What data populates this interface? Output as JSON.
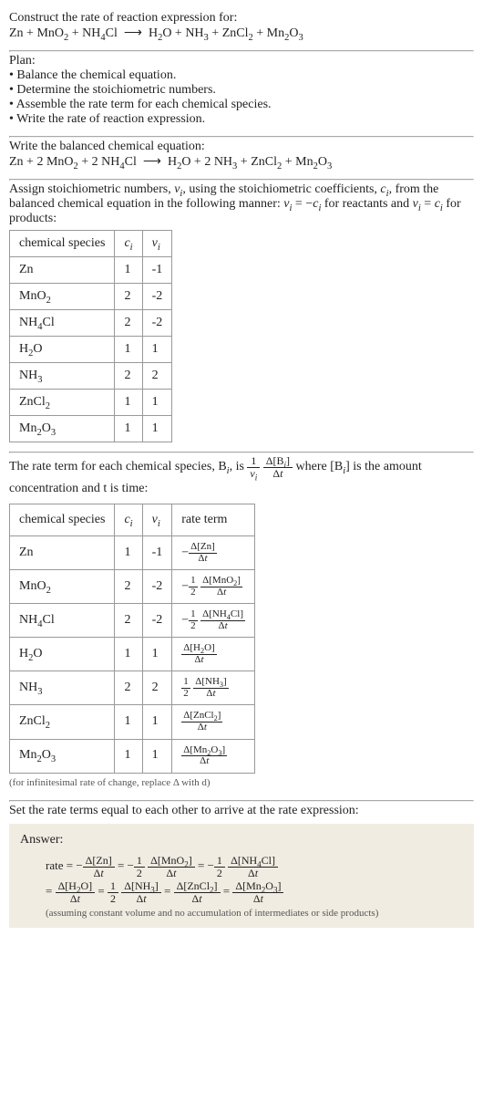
{
  "header": {
    "title": "Construct the rate of reaction expression for:",
    "equation_html": "Zn + MnO<sub>2</sub> + NH<sub>4</sub>Cl &nbsp;⟶&nbsp; H<sub>2</sub>O + NH<sub>3</sub> + ZnCl<sub>2</sub> + Mn<sub>2</sub>O<sub>3</sub>"
  },
  "plan": {
    "label": "Plan:",
    "items": [
      "Balance the chemical equation.",
      "Determine the stoichiometric numbers.",
      "Assemble the rate term for each chemical species.",
      "Write the rate of reaction expression."
    ]
  },
  "balanced": {
    "label": "Write the balanced chemical equation:",
    "equation_html": "Zn + 2 MnO<sub>2</sub> + 2 NH<sub>4</sub>Cl &nbsp;⟶&nbsp; H<sub>2</sub>O + 2 NH<sub>3</sub> + ZnCl<sub>2</sub> + Mn<sub>2</sub>O<sub>3</sub>"
  },
  "stoich_intro_html": "Assign stoichiometric numbers, <i>ν<sub>i</sub></i>, using the stoichiometric coefficients, <i>c<sub>i</sub></i>, from the balanced chemical equation in the following manner: <i>ν<sub>i</sub></i> = −<i>c<sub>i</sub></i> for reactants and <i>ν<sub>i</sub></i> = <i>c<sub>i</sub></i> for products:",
  "stoich_table": {
    "headers": [
      "chemical species",
      "c_i",
      "ν_i"
    ],
    "rows": [
      {
        "species_html": "Zn",
        "c": "1",
        "nu": "-1"
      },
      {
        "species_html": "MnO<sub>2</sub>",
        "c": "2",
        "nu": "-2"
      },
      {
        "species_html": "NH<sub>4</sub>Cl",
        "c": "2",
        "nu": "-2"
      },
      {
        "species_html": "H<sub>2</sub>O",
        "c": "1",
        "nu": "1"
      },
      {
        "species_html": "NH<sub>3</sub>",
        "c": "2",
        "nu": "2"
      },
      {
        "species_html": "ZnCl<sub>2</sub>",
        "c": "1",
        "nu": "1"
      },
      {
        "species_html": "Mn<sub>2</sub>O<sub>3</sub>",
        "c": "1",
        "nu": "1"
      }
    ]
  },
  "rate_term_intro": {
    "pre": "The rate term for each chemical species, B",
    "mid1": ", is ",
    "frac1_num": "1",
    "frac1_den_html": "<i>ν<sub>i</sub></i>",
    "frac2_num_html": "Δ[B<sub><i>i</i></sub>]",
    "frac2_den_html": "Δ<i>t</i>",
    "mid2": " where [B",
    "post": "] is the amount concentration and t is time:"
  },
  "rate_table": {
    "headers": [
      "chemical species",
      "c_i",
      "ν_i",
      "rate term"
    ],
    "rows": [
      {
        "species_html": "Zn",
        "c": "1",
        "nu": "-1",
        "rate_html": "−<span class=\"frac\"><span class=\"num\">Δ[Zn]</span><span class=\"den\">Δ<i>t</i></span></span>"
      },
      {
        "species_html": "MnO<sub>2</sub>",
        "c": "2",
        "nu": "-2",
        "rate_html": "−<span class=\"frac\"><span class=\"num\">1</span><span class=\"den\">2</span></span> <span class=\"frac\"><span class=\"num\">Δ[MnO<sub>2</sub>]</span><span class=\"den\">Δ<i>t</i></span></span>"
      },
      {
        "species_html": "NH<sub>4</sub>Cl",
        "c": "2",
        "nu": "-2",
        "rate_html": "−<span class=\"frac\"><span class=\"num\">1</span><span class=\"den\">2</span></span> <span class=\"frac\"><span class=\"num\">Δ[NH<sub>4</sub>Cl]</span><span class=\"den\">Δ<i>t</i></span></span>"
      },
      {
        "species_html": "H<sub>2</sub>O",
        "c": "1",
        "nu": "1",
        "rate_html": "<span class=\"frac\"><span class=\"num\">Δ[H<sub>2</sub>O]</span><span class=\"den\">Δ<i>t</i></span></span>"
      },
      {
        "species_html": "NH<sub>3</sub>",
        "c": "2",
        "nu": "2",
        "rate_html": "<span class=\"frac\"><span class=\"num\">1</span><span class=\"den\">2</span></span> <span class=\"frac\"><span class=\"num\">Δ[NH<sub>3</sub>]</span><span class=\"den\">Δ<i>t</i></span></span>"
      },
      {
        "species_html": "ZnCl<sub>2</sub>",
        "c": "1",
        "nu": "1",
        "rate_html": "<span class=\"frac\"><span class=\"num\">Δ[ZnCl<sub>2</sub>]</span><span class=\"den\">Δ<i>t</i></span></span>"
      },
      {
        "species_html": "Mn<sub>2</sub>O<sub>3</sub>",
        "c": "1",
        "nu": "1",
        "rate_html": "<span class=\"frac\"><span class=\"num\">Δ[Mn<sub>2</sub>O<sub>3</sub>]</span><span class=\"den\">Δ<i>t</i></span></span>"
      }
    ],
    "note": "(for infinitesimal rate of change, replace Δ with d)"
  },
  "set_equal": "Set the rate terms equal to each other to arrive at the rate expression:",
  "answer": {
    "label": "Answer:",
    "line1_html": "rate = −<span class=\"inline-frac\"><span class=\"num\">Δ[Zn]</span><span class=\"den\">Δ<i>t</i></span></span> = −<span class=\"inline-frac\"><span class=\"num\">1</span><span class=\"den\">2</span></span> <span class=\"inline-frac\"><span class=\"num\">Δ[MnO<sub>2</sub>]</span><span class=\"den\">Δ<i>t</i></span></span> = −<span class=\"inline-frac\"><span class=\"num\">1</span><span class=\"den\">2</span></span> <span class=\"inline-frac\"><span class=\"num\">Δ[NH<sub>4</sub>Cl]</span><span class=\"den\">Δ<i>t</i></span></span>",
    "line2_html": "= <span class=\"inline-frac\"><span class=\"num\">Δ[H<sub>2</sub>O]</span><span class=\"den\">Δ<i>t</i></span></span> = <span class=\"inline-frac\"><span class=\"num\">1</span><span class=\"den\">2</span></span> <span class=\"inline-frac\"><span class=\"num\">Δ[NH<sub>3</sub>]</span><span class=\"den\">Δ<i>t</i></span></span> = <span class=\"inline-frac\"><span class=\"num\">Δ[ZnCl<sub>2</sub>]</span><span class=\"den\">Δ<i>t</i></span></span> = <span class=\"inline-frac\"><span class=\"num\">Δ[Mn<sub>2</sub>O<sub>3</sub>]</span><span class=\"den\">Δ<i>t</i></span></span>",
    "note": "(assuming constant volume and no accumulation of intermediates or side products)"
  },
  "chart_data": {
    "type": "table",
    "title": "Stoichiometric numbers and rate terms",
    "species": [
      "Zn",
      "MnO2",
      "NH4Cl",
      "H2O",
      "NH3",
      "ZnCl2",
      "Mn2O3"
    ],
    "c_i": [
      1,
      2,
      2,
      1,
      2,
      1,
      1
    ],
    "nu_i": [
      -1,
      -2,
      -2,
      1,
      2,
      1,
      1
    ],
    "rate_terms": [
      "-Δ[Zn]/Δt",
      "-(1/2) Δ[MnO2]/Δt",
      "-(1/2) Δ[NH4Cl]/Δt",
      "Δ[H2O]/Δt",
      "(1/2) Δ[NH3]/Δt",
      "Δ[ZnCl2]/Δt",
      "Δ[Mn2O3]/Δt"
    ],
    "rate_expression": "rate = -Δ[Zn]/Δt = -(1/2)Δ[MnO2]/Δt = -(1/2)Δ[NH4Cl]/Δt = Δ[H2O]/Δt = (1/2)Δ[NH3]/Δt = Δ[ZnCl2]/Δt = Δ[Mn2O3]/Δt"
  }
}
